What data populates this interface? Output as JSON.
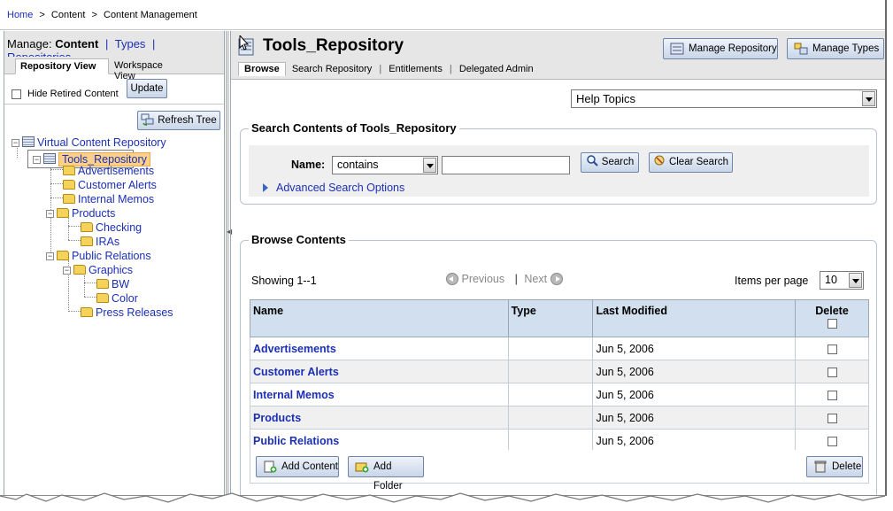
{
  "breadcrumb": {
    "home": "Home",
    "sep1": ">",
    "content": "Content",
    "sep2": ">",
    "current": "Content Management"
  },
  "left": {
    "manage_label": "Manage:",
    "manage_current": "Content",
    "sep": "|",
    "types_link": "Types",
    "repositories_link": "Repositories",
    "tabs": [
      {
        "label": "Repository View"
      },
      {
        "label": "Workspace View"
      }
    ],
    "hide_retired_label": "Hide Retired Content",
    "update_button": "Update",
    "refresh_button": "Refresh Tree"
  },
  "tree": {
    "root": "Virtual Content Repository",
    "repo": "Tools_Repository",
    "items": {
      "advertisements": "Advertisements",
      "customer_alerts": "Customer Alerts",
      "internal_memos": "Internal Memos",
      "products": "Products",
      "checking": "Checking",
      "iras": "IRAs",
      "public_relations": "Public Relations",
      "graphics": "Graphics",
      "bw": "BW",
      "color": "Color",
      "press_releases": "Press Releases"
    }
  },
  "right": {
    "title": "Tools_Repository",
    "manage_repository_button": "Manage Repository",
    "manage_types_button": "Manage Types",
    "tabs": [
      {
        "label": "Browse"
      },
      {
        "label": "Search Repository"
      },
      {
        "label": "Entitlements"
      },
      {
        "label": "Delegated Admin"
      }
    ],
    "tab_sep": "|",
    "help_topics": "Help Topics"
  },
  "search": {
    "legend": "Search Contents of Tools_Repository",
    "name_label": "Name:",
    "operator": "contains",
    "query": "",
    "search_button": "Search",
    "clear_button": "Clear Search",
    "advanced_link": "Advanced Search Options"
  },
  "browse": {
    "legend": "Browse Contents",
    "showing": "Showing 1--1",
    "previous": "Previous",
    "pager_sep": "|",
    "next": "Next",
    "items_per_page_label": "Items per page",
    "items_per_page": "10",
    "columns": {
      "name": "Name",
      "type": "Type",
      "modified": "Last Modified",
      "delete": "Delete"
    },
    "rows": [
      {
        "name": "Advertisements",
        "type": "",
        "modified": "Jun 5, 2006"
      },
      {
        "name": "Customer Alerts",
        "type": "",
        "modified": "Jun 5, 2006"
      },
      {
        "name": "Internal Memos",
        "type": "",
        "modified": "Jun 5, 2006"
      },
      {
        "name": "Products",
        "type": "",
        "modified": "Jun 5, 2006"
      },
      {
        "name": "Public Relations",
        "type": "",
        "modified": "Jun 5, 2006"
      }
    ],
    "add_content_button": "Add Content",
    "add_folder_button": "Add Folder",
    "delete_button": "Delete"
  },
  "colors": {
    "link": "#1b2fb5",
    "header_bg": "#d2dfee",
    "panel_bg": "#e6e6e6",
    "selection": "#fbd08a"
  },
  "icons": [
    "repository-icon",
    "folder-icon",
    "refresh-icon",
    "search-icon",
    "clear-search-icon",
    "add-content-icon",
    "add-folder-icon",
    "trash-icon",
    "cursor-icon"
  ]
}
